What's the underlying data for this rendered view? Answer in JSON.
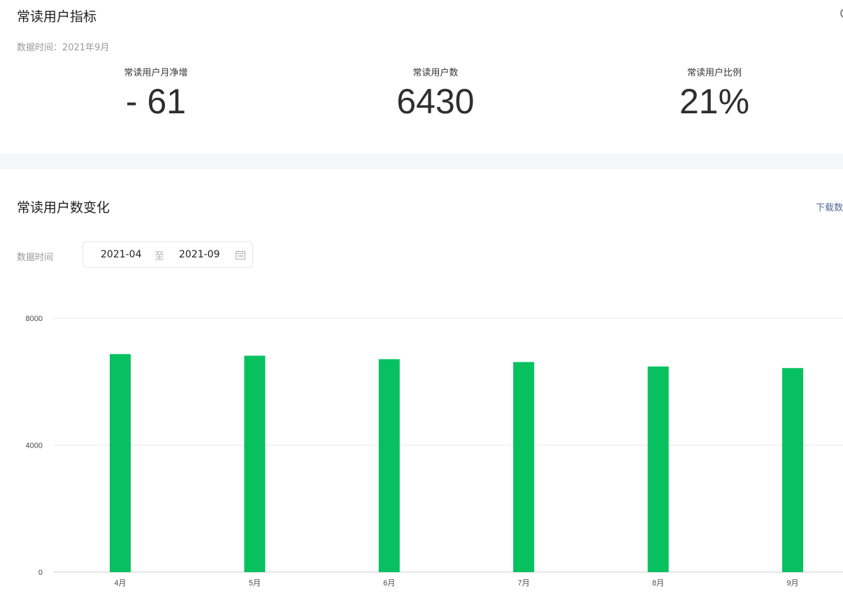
{
  "metrics_section": {
    "title": "常读用户指标",
    "data_time": "数据时间：2021年9月",
    "metrics": [
      {
        "label": "常读用户月净增",
        "value": "- 61"
      },
      {
        "label": "常读用户数",
        "value": "6430"
      },
      {
        "label": "常读用户比例",
        "value": "21%"
      }
    ]
  },
  "trend_section": {
    "title": "常读用户数变化",
    "download_label": "下载数",
    "date_filter": {
      "label": "数据时间",
      "start": "2021-04",
      "separator": "至",
      "end": "2021-09",
      "icon": "calendar-icon"
    }
  },
  "colors": {
    "bar": "#07c160",
    "link": "#576b95"
  },
  "chart_data": {
    "type": "bar",
    "categories": [
      "4月",
      "5月",
      "6月",
      "7月",
      "8月",
      "9月"
    ],
    "values": [
      6870,
      6820,
      6710,
      6620,
      6480,
      6430
    ],
    "yticks": [
      0,
      4000,
      8000
    ],
    "ylim": [
      0,
      8000
    ],
    "grid": true,
    "title": "",
    "xlabel": "",
    "ylabel": ""
  }
}
